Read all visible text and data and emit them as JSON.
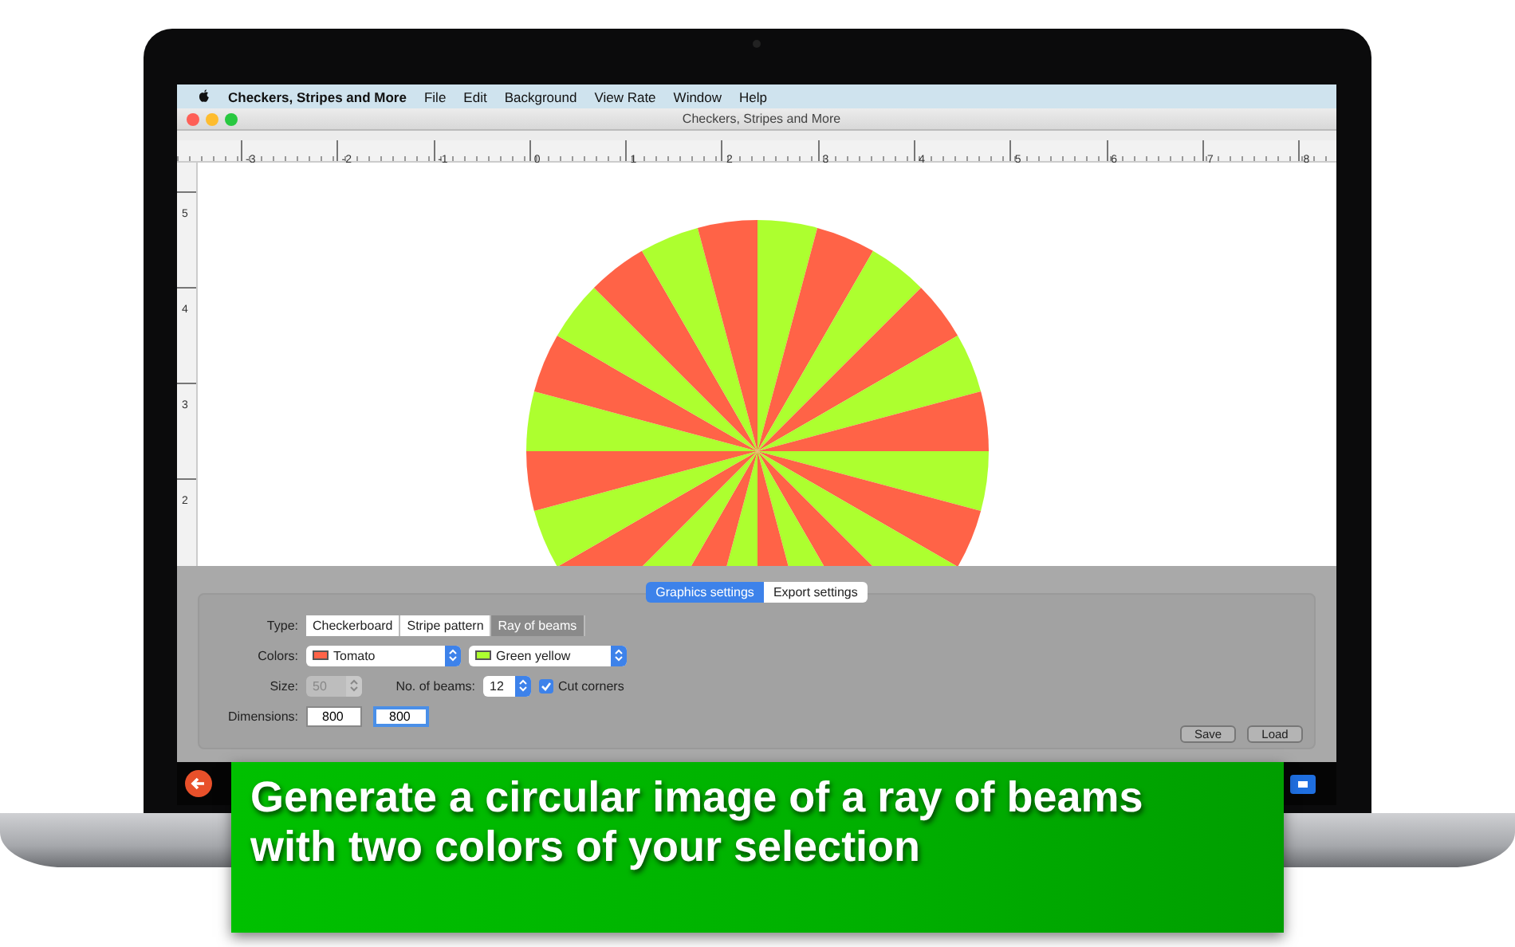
{
  "menu_bar": {
    "app_name": "Checkers, Stripes and More",
    "items": [
      "File",
      "Edit",
      "Background",
      "View Rate",
      "Window",
      "Help"
    ]
  },
  "window": {
    "title": "Checkers, Stripes and More"
  },
  "rulers": {
    "horizontal": [
      "-3",
      "-2",
      "-1",
      "0",
      "1",
      "2",
      "3",
      "4",
      "5",
      "6",
      "7",
      "8"
    ],
    "vertical": [
      "5",
      "4",
      "3",
      "2"
    ]
  },
  "settings_tabs": [
    {
      "label": "Graphics settings",
      "selected": true
    },
    {
      "label": "Export settings",
      "selected": false
    }
  ],
  "form": {
    "type": {
      "label": "Type:",
      "options": [
        {
          "label": "Checkerboard",
          "selected": false
        },
        {
          "label": "Stripe pattern",
          "selected": false
        },
        {
          "label": "Ray of beams",
          "selected": true
        }
      ]
    },
    "colors": {
      "label": "Colors:",
      "choices": [
        {
          "value": "Tomato",
          "color": "#ff6347"
        },
        {
          "value": "Green yellow",
          "color": "#adff2f"
        }
      ]
    },
    "size": {
      "label": "Size:",
      "value": "50",
      "disabled": true
    },
    "beams": {
      "label": "No. of beams:",
      "value": "12"
    },
    "cut_corners": {
      "label": "Cut corners",
      "checked": true
    },
    "dimensions": {
      "label": "Dimensions:",
      "fields": [
        {
          "value": "800",
          "focused": false
        },
        {
          "value": "800",
          "focused": true
        }
      ]
    }
  },
  "buttons": [
    "Save",
    "Load"
  ],
  "banner": {
    "lines": [
      "Generate a circular image of a ray of beams",
      "with two colors of your selection"
    ]
  }
}
